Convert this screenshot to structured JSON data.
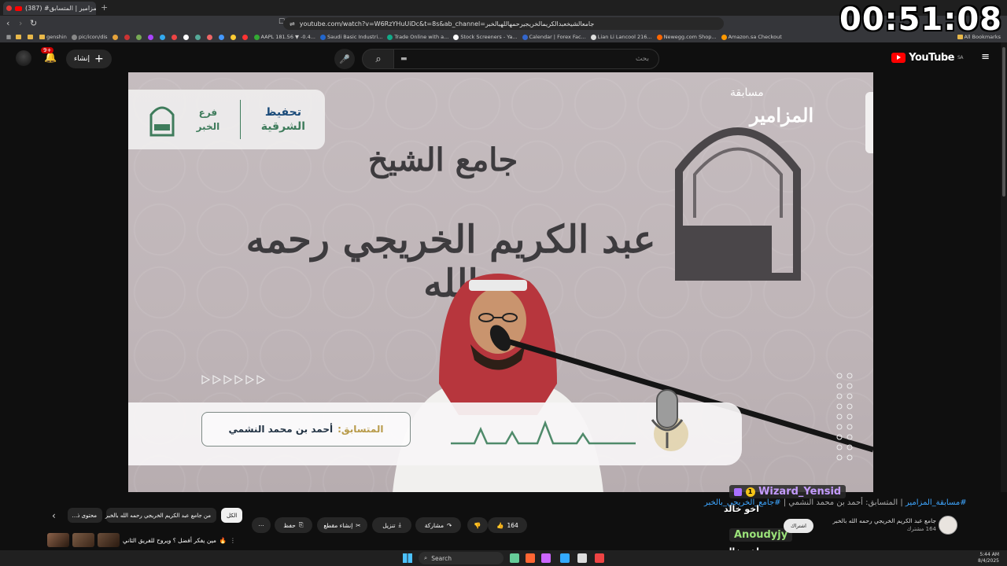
{
  "browser": {
    "tab_title": "(387) #مسابقة_المزامير | المتسابق",
    "tab_close": "×",
    "new_tab": "+",
    "url": "youtube.com/watch?v=W6RzYHuUiDc&t=8s&ab_channel=جامعالشيخعبدالكريمالخريجيرحمهاللهبالخبر",
    "bookmarks": [
      "genshin",
      "pic/icon/dis",
      "AAPL 181.56 ▼ -0.4...",
      "Saudi Basic Industri...",
      "Trade Online with a...",
      "Stock Screeners - Ya...",
      "Calendar | Forex Fac...",
      "Lian Li Lancool 216...",
      "Newegg.com Shop...",
      "Amazon.sa Checkout",
      "All Bookmarks"
    ]
  },
  "stream_timer": "00:51:08",
  "youtube": {
    "logo": "YouTube",
    "region": "SA",
    "search_placeholder": "بحث",
    "create_label": "إنشاء",
    "notifications": "9+"
  },
  "video": {
    "logo_panel": {
      "tahfeez_line1": "تحفيظ",
      "tahfeez_line2": "الشرقية",
      "branch_line1": "فرع",
      "branch_line2": "الخبر"
    },
    "calligraphy_line1": "جامع الشيخ",
    "calligraphy_line2": "عبد الكريم الخريجي رحمه الله",
    "brand_small": "مسابقة",
    "brand_large": "المزامير",
    "contestant_label": "المتسابق:",
    "contestant_name": "أحمد بن محمد النشمي",
    "play_arrows": "▷▷▷▷▷▷"
  },
  "chat": [
    {
      "user": "Wizard_Yensid",
      "badge": "1",
      "color": "#c49bff",
      "message": "اخو خالد"
    },
    {
      "user": "Anoudyjy",
      "color": "#9be37a",
      "message": "اخو خالد"
    }
  ],
  "video_info": {
    "hashtag": "#مسابقة_المزامير",
    "title_rest": " | المتسابق: أحمد بن محمد النشمي | ",
    "hashtag2": "#جامع_الخريجي_بالخبر",
    "channel_name": "جامع عبد الكريم الخريجي رحمه الله بالخبر",
    "subscribers": "164 مشترك",
    "subscribe": "اشتراك",
    "likes": "164",
    "share": "مشاركة",
    "download": "تنزيل",
    "clip": "إنشاء مقطع",
    "save": "حفظ",
    "more": "⋯"
  },
  "recommend_chips": [
    {
      "label": "الكل",
      "active": true
    },
    {
      "label": "من جامع عبد الكريم الخريجي رحمه الله بالخبر",
      "active": false
    },
    {
      "label": "محتوى ذ...",
      "active": false
    }
  ],
  "short_title": "مين يفكر أفضل ؟ ويروح للفريق الثاني",
  "taskbar": {
    "search": "Search",
    "time": "5:44 AM",
    "date": "8/4/2025"
  }
}
